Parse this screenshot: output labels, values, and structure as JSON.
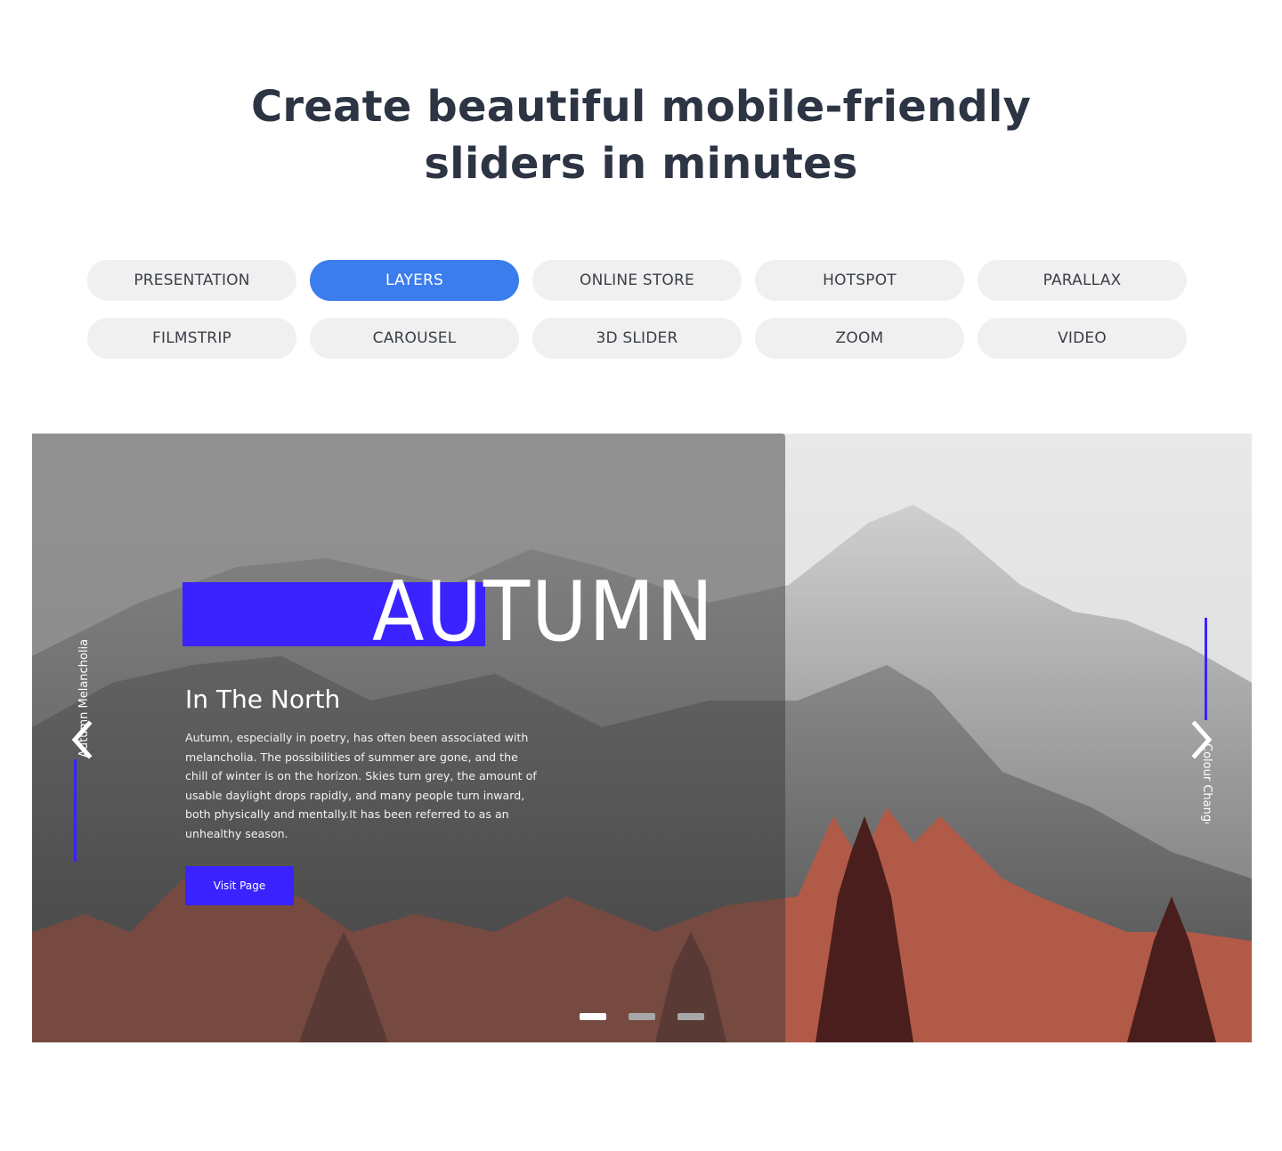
{
  "headline": {
    "line1": "Create beautiful mobile-friendly",
    "line2": "sliders in minutes"
  },
  "tabs": [
    {
      "label": "PRESENTATION",
      "active": false
    },
    {
      "label": "LAYERS",
      "active": true
    },
    {
      "label": "ONLINE STORE",
      "active": false
    },
    {
      "label": "HOTSPOT",
      "active": false
    },
    {
      "label": "PARALLAX",
      "active": false
    },
    {
      "label": "FILMSTRIP",
      "active": false
    },
    {
      "label": "CAROUSEL",
      "active": false
    },
    {
      "label": "3D SLIDER",
      "active": false
    },
    {
      "label": "ZOOM",
      "active": false
    },
    {
      "label": "VIDEO",
      "active": false
    }
  ],
  "slide": {
    "title": "AUTUMN",
    "subtitle": "In The North",
    "body": "Autumn, especially in poetry, has often been associated with melancholia. The possibilities of summer are gone, and the chill of winter is on the horizon. Skies turn grey, the amount of usable daylight drops rapidly, and many people turn inward, both physically and mentally.It has been referred to as an unhealthy season.",
    "button_label": "Visit Page",
    "prev_label": "Autumn Melancholia",
    "next_label": "Colour Change"
  },
  "pagination": {
    "count": 3,
    "active_index": 0
  },
  "icons": {
    "prev": "chevron-left-icon",
    "next": "chevron-right-icon"
  },
  "colors": {
    "accent_blue": "#3b7ded",
    "layer_accent": "#3a23ff",
    "headline": "#2d3544",
    "tab_bg": "#f0f0f0",
    "foliage": "#b25a48"
  }
}
